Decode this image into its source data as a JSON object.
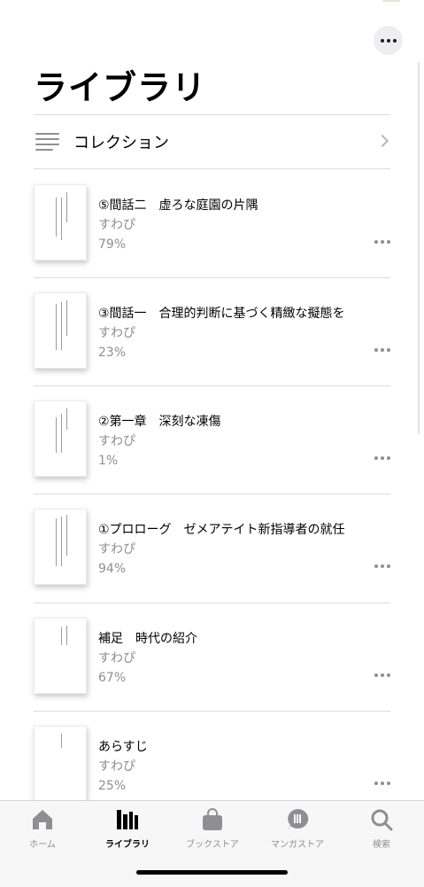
{
  "header": {
    "title": "ライブラリ",
    "more_icon": "ellipsis-icon"
  },
  "collections": {
    "label": "コレクション",
    "icon": "list-icon",
    "chevron": "chevron-right-icon"
  },
  "books": [
    {
      "title": "⑤間話二　虚ろな庭園の片隅",
      "author": "すわぴ",
      "progress": "79%"
    },
    {
      "title": "③間話一　合理的判断に基づく精緻な擬態を",
      "author": "すわぴ",
      "progress": "23%"
    },
    {
      "title": "②第一章　深刻な凍傷",
      "author": "すわぴ",
      "progress": "1%"
    },
    {
      "title": "①プロローグ　ゼメアテイト新指導者の就任",
      "author": "すわぴ",
      "progress": "94%"
    },
    {
      "title": "補足　時代の紹介",
      "author": "すわぴ",
      "progress": "67%"
    },
    {
      "title": "あらすじ",
      "author": "すわぴ",
      "progress": "25%"
    }
  ],
  "tabbar": {
    "active": "library",
    "tabs": [
      {
        "id": "home",
        "label": "ホーム",
        "icon": "home-icon"
      },
      {
        "id": "library",
        "label": "ライブラリ",
        "icon": "library-icon"
      },
      {
        "id": "bookstore",
        "label": "ブックストア",
        "icon": "shopping-bag-icon"
      },
      {
        "id": "manga",
        "label": "マンガストア",
        "icon": "manga-icon"
      },
      {
        "id": "search",
        "label": "検索",
        "icon": "search-icon"
      }
    ]
  },
  "colors": {
    "secondary_text": "#8e8e93",
    "tab_bar_background": "#f7f7f7",
    "active_tab": "#000000"
  }
}
